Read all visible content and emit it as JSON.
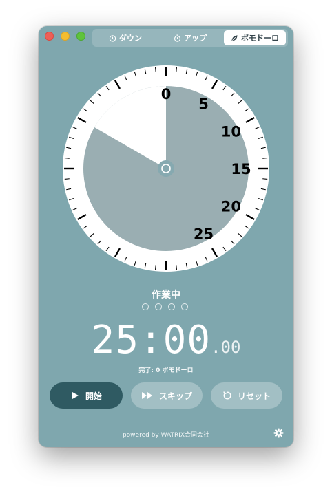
{
  "tabs": [
    {
      "label": "ダウン",
      "icon": "timer-icon"
    },
    {
      "label": "アップ",
      "icon": "stopwatch-icon"
    },
    {
      "label": "ポモドーロ",
      "icon": "leaf-icon",
      "selected": true
    }
  ],
  "dial": {
    "labels": [
      "0",
      "5",
      "10",
      "15",
      "20",
      "25"
    ],
    "colors": {
      "face": "#9aaeb2",
      "remaining": "#ffffff",
      "ring": "#ffffff"
    }
  },
  "status": {
    "label": "作業中",
    "session_dots": 4
  },
  "timer": {
    "minutes": "25",
    "separator": ":",
    "seconds": "00",
    "centiseconds": ".00"
  },
  "completed_text": "完了: 0 ポモドーロ",
  "buttons": {
    "start": "開始",
    "skip": "スキップ",
    "reset": "リセット"
  },
  "footer": "powered by WATRIX合同会社",
  "colors": {
    "window_bg": "#7fa7ae",
    "start_button": "#2f5a62"
  }
}
